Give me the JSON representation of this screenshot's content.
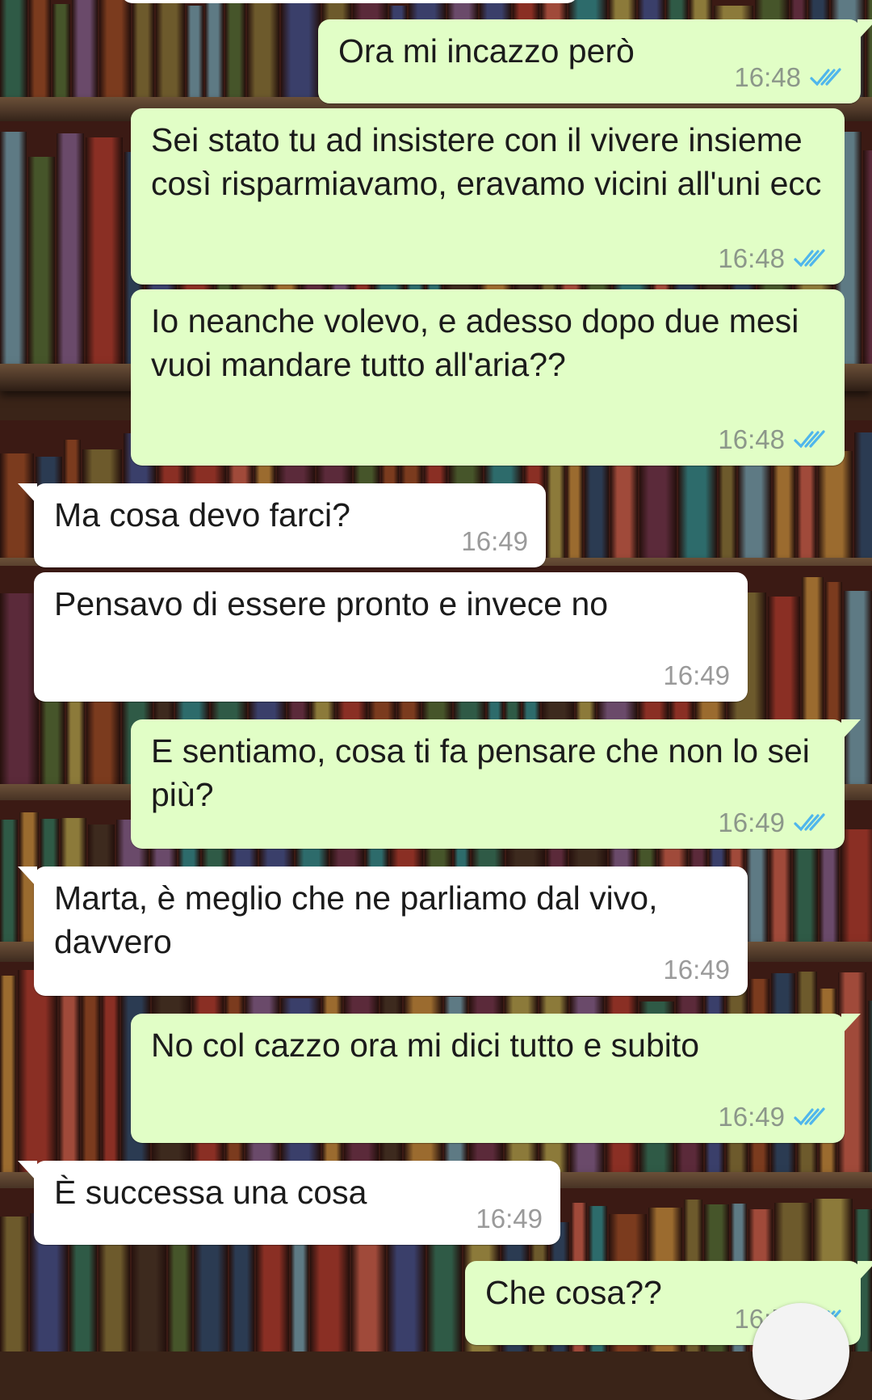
{
  "colors": {
    "outgoing_bubble": "#e1fec6",
    "incoming_bubble": "#ffffff",
    "read_ticks": "#4fb6ec",
    "timestamp": "#8c978a"
  },
  "messages": [
    {
      "id": "m1",
      "direction": "outgoing",
      "text": "Ora mi incazzo però",
      "time": "16:48",
      "status": "read",
      "tail": true
    },
    {
      "id": "m2",
      "direction": "outgoing",
      "text": "Sei stato tu ad insistere con il vivere insieme così risparmiavamo, eravamo vicini all'uni ecc",
      "time": "16:48",
      "status": "read",
      "tail": false
    },
    {
      "id": "m3",
      "direction": "outgoing",
      "text": "Io neanche volevo, e adesso dopo due mesi vuoi mandare tutto all'aria??",
      "time": "16:48",
      "status": "read",
      "tail": false
    },
    {
      "id": "m4",
      "direction": "incoming",
      "text": "Ma cosa devo farci?",
      "time": "16:49",
      "tail": true
    },
    {
      "id": "m5",
      "direction": "incoming",
      "text": "Pensavo di essere pronto e invece no",
      "time": "16:49",
      "tail": false
    },
    {
      "id": "m6",
      "direction": "outgoing",
      "text": "E sentiamo, cosa ti fa pensare che non lo sei più?",
      "time": "16:49",
      "status": "read",
      "tail": true
    },
    {
      "id": "m7",
      "direction": "incoming",
      "text": "Marta, è meglio che ne parliamo dal vivo, davvero",
      "time": "16:49",
      "tail": true
    },
    {
      "id": "m8",
      "direction": "outgoing",
      "text": "No col cazzo ora mi dici tutto e subito",
      "time": "16:49",
      "status": "read",
      "tail": true
    },
    {
      "id": "m9",
      "direction": "incoming",
      "text": "È successa una cosa",
      "time": "16:49",
      "tail": true
    },
    {
      "id": "m10",
      "direction": "outgoing",
      "text": "Che cosa??",
      "time": "16:50",
      "status": "read",
      "tail": true
    }
  ]
}
